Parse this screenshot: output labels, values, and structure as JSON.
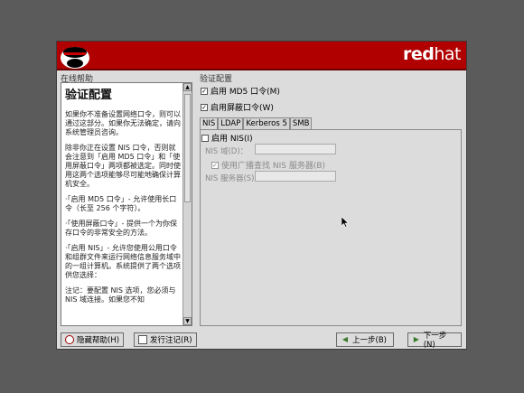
{
  "banner": {
    "brand_bold": "red",
    "brand_regular": "hat"
  },
  "help": {
    "section_title": "在线帮助",
    "heading": "验证配置",
    "paragraphs": [
      "如果你不准备设置网络口令，则可以通过这部分。如果你无法确定，请向系统管理员咨询。",
      "除非你正在设置 NIS 口令，否则就会注意到「启用 MD5 口令」和「使用屏蔽口令」两项都被选定。同时使用这两个选项能够尽可能地确保计算机安全。",
      "·「启用 MD5 口令」- 允许使用长口令（长至 256 个字符）。",
      "·「使用屏蔽口令」- 提供一个为你保存口令的非常安全的方法。",
      "·「启用 NIS」- 允许您使用公用口令和组群文件来运行网络信息服务域中的一组计算机。系统提供了两个选项供您选择：",
      "注记：要配置 NIS 选项，您必须与 NIS 域连接。如果您不知"
    ]
  },
  "auth": {
    "section_title": "验证配置",
    "md5_label": "启用 MD5 口令(M)",
    "md5_checked": true,
    "shadow_label": "启用屏蔽口令(W)",
    "shadow_checked": true
  },
  "tabs": [
    "NIS",
    "LDAP",
    "Kerberos 5",
    "SMB"
  ],
  "active_tab": "NIS",
  "nis": {
    "enable_label": "启用 NIS(I)",
    "enable_checked": false,
    "domain_label": "NIS 域(D)：",
    "domain_value": "",
    "broadcast_label": "使用广播查找 NIS 服务器(B)",
    "broadcast_checked": true,
    "server_label": "NIS 服务器(S)：",
    "server_value": ""
  },
  "buttons": {
    "hide_help": "隐藏帮助(H)",
    "release_notes": "发行注记(R)",
    "back": "上一步(B)",
    "next": "下一步(N)"
  }
}
